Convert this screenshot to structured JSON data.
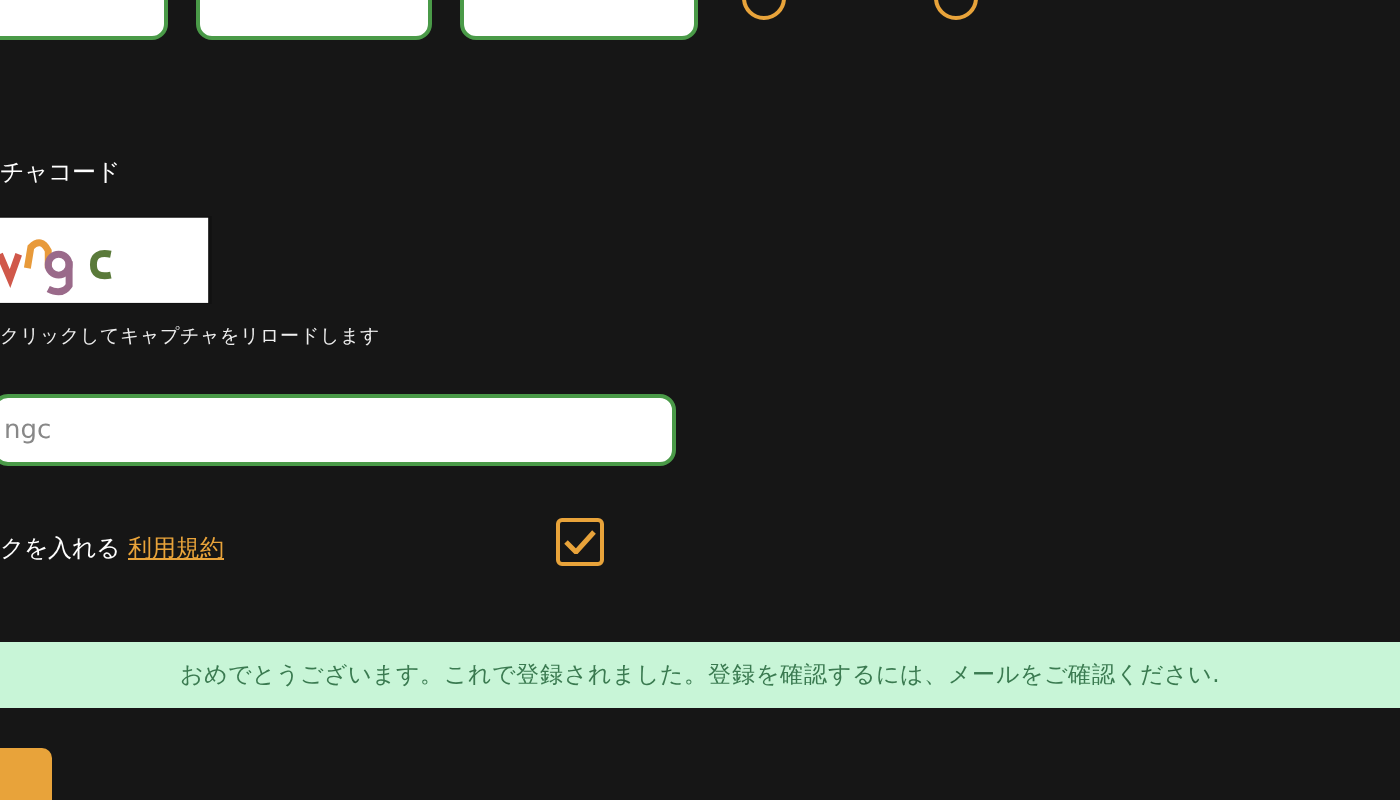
{
  "gender_options": [
    {
      "selected": false
    },
    {
      "selected": false
    }
  ],
  "captcha": {
    "label": "チャコード",
    "hint": "クリックしてキャプチャをリロードします",
    "input": {
      "placeholder": "ngc"
    }
  },
  "terms": {
    "text": "クを入れる",
    "link": "利用規約",
    "checked": true
  },
  "banner": {
    "message": "おめでとうございます。これで登録されました。登録を確認するには、メールをご確認ください."
  }
}
